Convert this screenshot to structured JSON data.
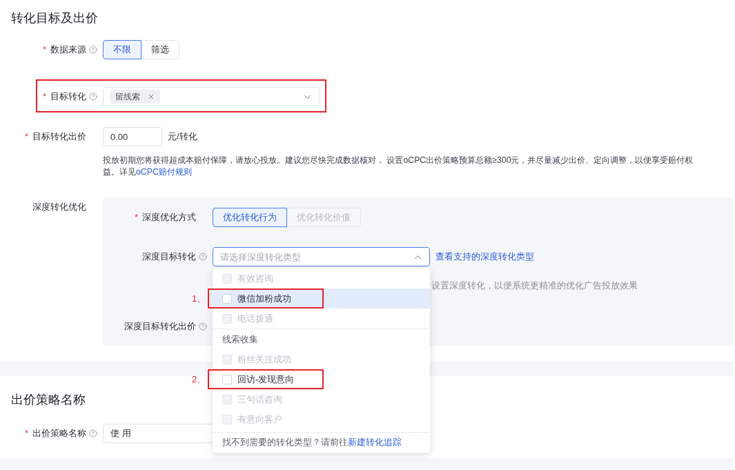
{
  "conversion_section": {
    "title": "转化目标及出价",
    "data_source": {
      "required_mark": "*",
      "label": "数据来源",
      "help": true,
      "options": [
        {
          "label": "不限",
          "selected": true
        },
        {
          "label": "筛选",
          "selected": false
        }
      ]
    },
    "target_conversion": {
      "required_mark": "*",
      "label": "目标转化",
      "help": true,
      "framed": true,
      "expanded": false,
      "tags": [
        {
          "label": "留线索"
        }
      ]
    },
    "target_bid": {
      "required_mark": "*",
      "label": "目标转化出价",
      "help": false,
      "value": "0.00",
      "unit": "元/转化",
      "hint": "投放初期您将获得超成本赔付保障，请放心投放。建议您尽快完成数据核对， 设置oCPC出价策略预算总额≥300元，并尽量减少出价、定向调整，以便享受赔付权益。详见",
      "hint_link": "oCPC赔付规则"
    },
    "deep_conversion": {
      "label": "深度转化优化",
      "help": false,
      "method": {
        "required_mark": "*",
        "label": "深度优化方式",
        "help": false,
        "options": [
          {
            "label": "优化转化行为",
            "selected": true,
            "disabled": false
          },
          {
            "label": "优化转化价值",
            "selected": false,
            "disabled": true
          }
        ]
      },
      "deep_target": {
        "label": "深度目标转化",
        "help": true,
        "placeholder": "请选择深度转化类型",
        "expanded": true,
        "link": "查看支持的深度转化类型",
        "hint": "设置深度转化，以便系统更精准的优化广告投放效果",
        "options": [
          {
            "kind": "option",
            "label": "有效咨询",
            "disabled": true,
            "checked": false,
            "highlighted": false
          },
          {
            "kind": "option",
            "label": "微信加粉成功",
            "disabled": false,
            "checked": false,
            "highlighted": true,
            "callout": "1、"
          },
          {
            "kind": "option",
            "label": "电话拨通",
            "disabled": true,
            "checked": false,
            "highlighted": false
          },
          {
            "kind": "group",
            "label": "线索收集"
          },
          {
            "kind": "option",
            "label": "粉丝关注成功",
            "disabled": true,
            "checked": false,
            "highlighted": false
          },
          {
            "kind": "option",
            "label": "回访-发现意向",
            "disabled": false,
            "checked": false,
            "highlighted": false,
            "callout": "2、"
          },
          {
            "kind": "option",
            "label": "三句话咨询",
            "disabled": true,
            "checked": false,
            "highlighted": false
          },
          {
            "kind": "option",
            "label": "有意向客户",
            "disabled": true,
            "checked": false,
            "highlighted": false
          }
        ],
        "footer": {
          "text": "找不到需要的转化类型？请前往",
          "link": "新建转化追踪"
        }
      },
      "deep_bid": {
        "label": "深度目标转化出价",
        "help": true
      }
    }
  },
  "strategy_section": {
    "title": "出价策略名称",
    "name": {
      "required_mark": "*",
      "label": "出价策略名称",
      "help": true,
      "value": "使 用"
    }
  }
}
